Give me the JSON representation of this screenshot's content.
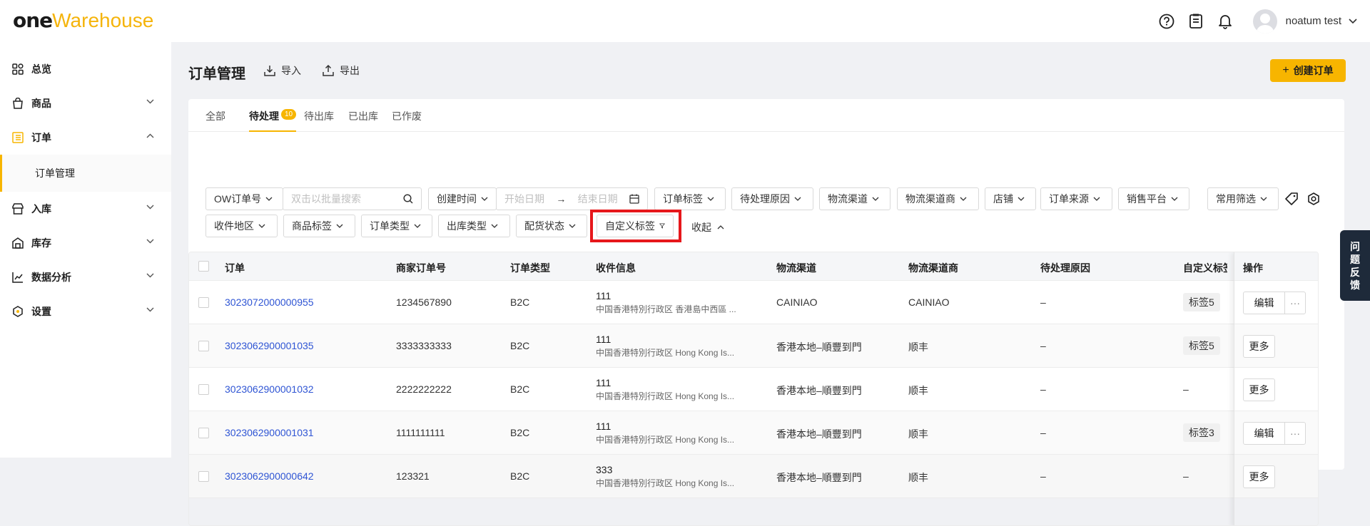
{
  "app": {
    "logo_one": "one",
    "logo_warehouse": "Warehouse",
    "user_name": "noatum test"
  },
  "header_icons": [
    "help-icon",
    "clipboard-icon",
    "bell-icon",
    "chevron-down-icon"
  ],
  "sidebar": {
    "items": [
      {
        "label": "总览",
        "icon": "dashboard-icon"
      },
      {
        "label": "商品",
        "icon": "bag-icon"
      },
      {
        "label": "订单",
        "icon": "order-icon"
      },
      {
        "label": "订单管理"
      },
      {
        "label": "入库",
        "icon": "store-icon"
      },
      {
        "label": "库存",
        "icon": "inventory-icon"
      },
      {
        "label": "数据分析",
        "icon": "chart-icon"
      },
      {
        "label": "设置",
        "icon": "hexagon-icon"
      }
    ]
  },
  "page": {
    "title": "订单管理",
    "import_label": "导入",
    "export_label": "导出",
    "create_label": "创建订单"
  },
  "tabs": [
    {
      "label": "全部"
    },
    {
      "label": "待处理",
      "badge": "10"
    },
    {
      "label": "待出库"
    },
    {
      "label": "已出库"
    },
    {
      "label": "已作废"
    }
  ],
  "filters": {
    "ow_order": "OW订单号",
    "search_placeholder": "双击以批量搜索",
    "create_time": "创建时间",
    "start_date": "开始日期",
    "arrow": "→",
    "end_date": "结束日期",
    "order_tag": "订单标签",
    "pending_reason": "待处理原因",
    "logistics_channel": "物流渠道",
    "logistics_provider": "物流渠道商",
    "store": "店铺",
    "order_source": "订单来源",
    "sales_platform": "销售平台",
    "common_filter": "常用筛选",
    "recipient_region": "收件地区",
    "product_tag": "商品标签",
    "order_type": "订单类型",
    "outbound_type": "出库类型",
    "allocation_status": "配货状态",
    "custom_tag": "自定义标签",
    "collapse": "收起"
  },
  "table": {
    "headers": [
      "订单",
      "商家订单号",
      "订单类型",
      "收件信息",
      "物流渠道",
      "物流渠道商",
      "待处理原因",
      "自定义标签",
      "操作"
    ],
    "rows": [
      {
        "order": "3023072000000955",
        "merchant_no": "1234567890",
        "type": "B2C",
        "name": "111",
        "addr": "中国香港特別行政区 香港島中西區 ...",
        "channel": "CAINIAO",
        "provider": "CAINIAO",
        "reason": "–",
        "tag": "标签5",
        "actions": [
          "编辑",
          "···"
        ]
      },
      {
        "order": "3023062900001035",
        "merchant_no": "3333333333",
        "type": "B2C",
        "name": "111",
        "addr": "中国香港特別行政区 Hong Kong Is...",
        "channel": "香港本地–順豐到門",
        "provider": "顺丰",
        "reason": "–",
        "tag": "标签5",
        "actions": [
          "更多"
        ]
      },
      {
        "order": "3023062900001032",
        "merchant_no": "2222222222",
        "type": "B2C",
        "name": "111",
        "addr": "中国香港特別行政区 Hong Kong Is...",
        "channel": "香港本地–順豐到門",
        "provider": "顺丰",
        "reason": "–",
        "tag": "–",
        "actions": [
          "更多"
        ]
      },
      {
        "order": "3023062900001031",
        "merchant_no": "1111111111",
        "type": "B2C",
        "name": "111",
        "addr": "中国香港特別行政区 Hong Kong Is...",
        "channel": "香港本地–順豐到門",
        "provider": "顺丰",
        "reason": "–",
        "tag": "标签3",
        "actions": [
          "编辑",
          "···"
        ]
      },
      {
        "order": "3023062900000642",
        "merchant_no": "123321",
        "type": "B2C",
        "name": "333",
        "addr": "中国香港特別行政区 Hong Kong Is...",
        "channel": "香港本地–順豐到門",
        "provider": "顺丰",
        "reason": "–",
        "tag": "–",
        "actions": [
          "更多"
        ]
      }
    ]
  },
  "feedback": {
    "line1": "问",
    "line2": "题",
    "line3": "反",
    "line4": "馈"
  },
  "colors": {
    "accent": "#f7b500",
    "link": "#2f55d4",
    "highlight": "#e6171b"
  }
}
